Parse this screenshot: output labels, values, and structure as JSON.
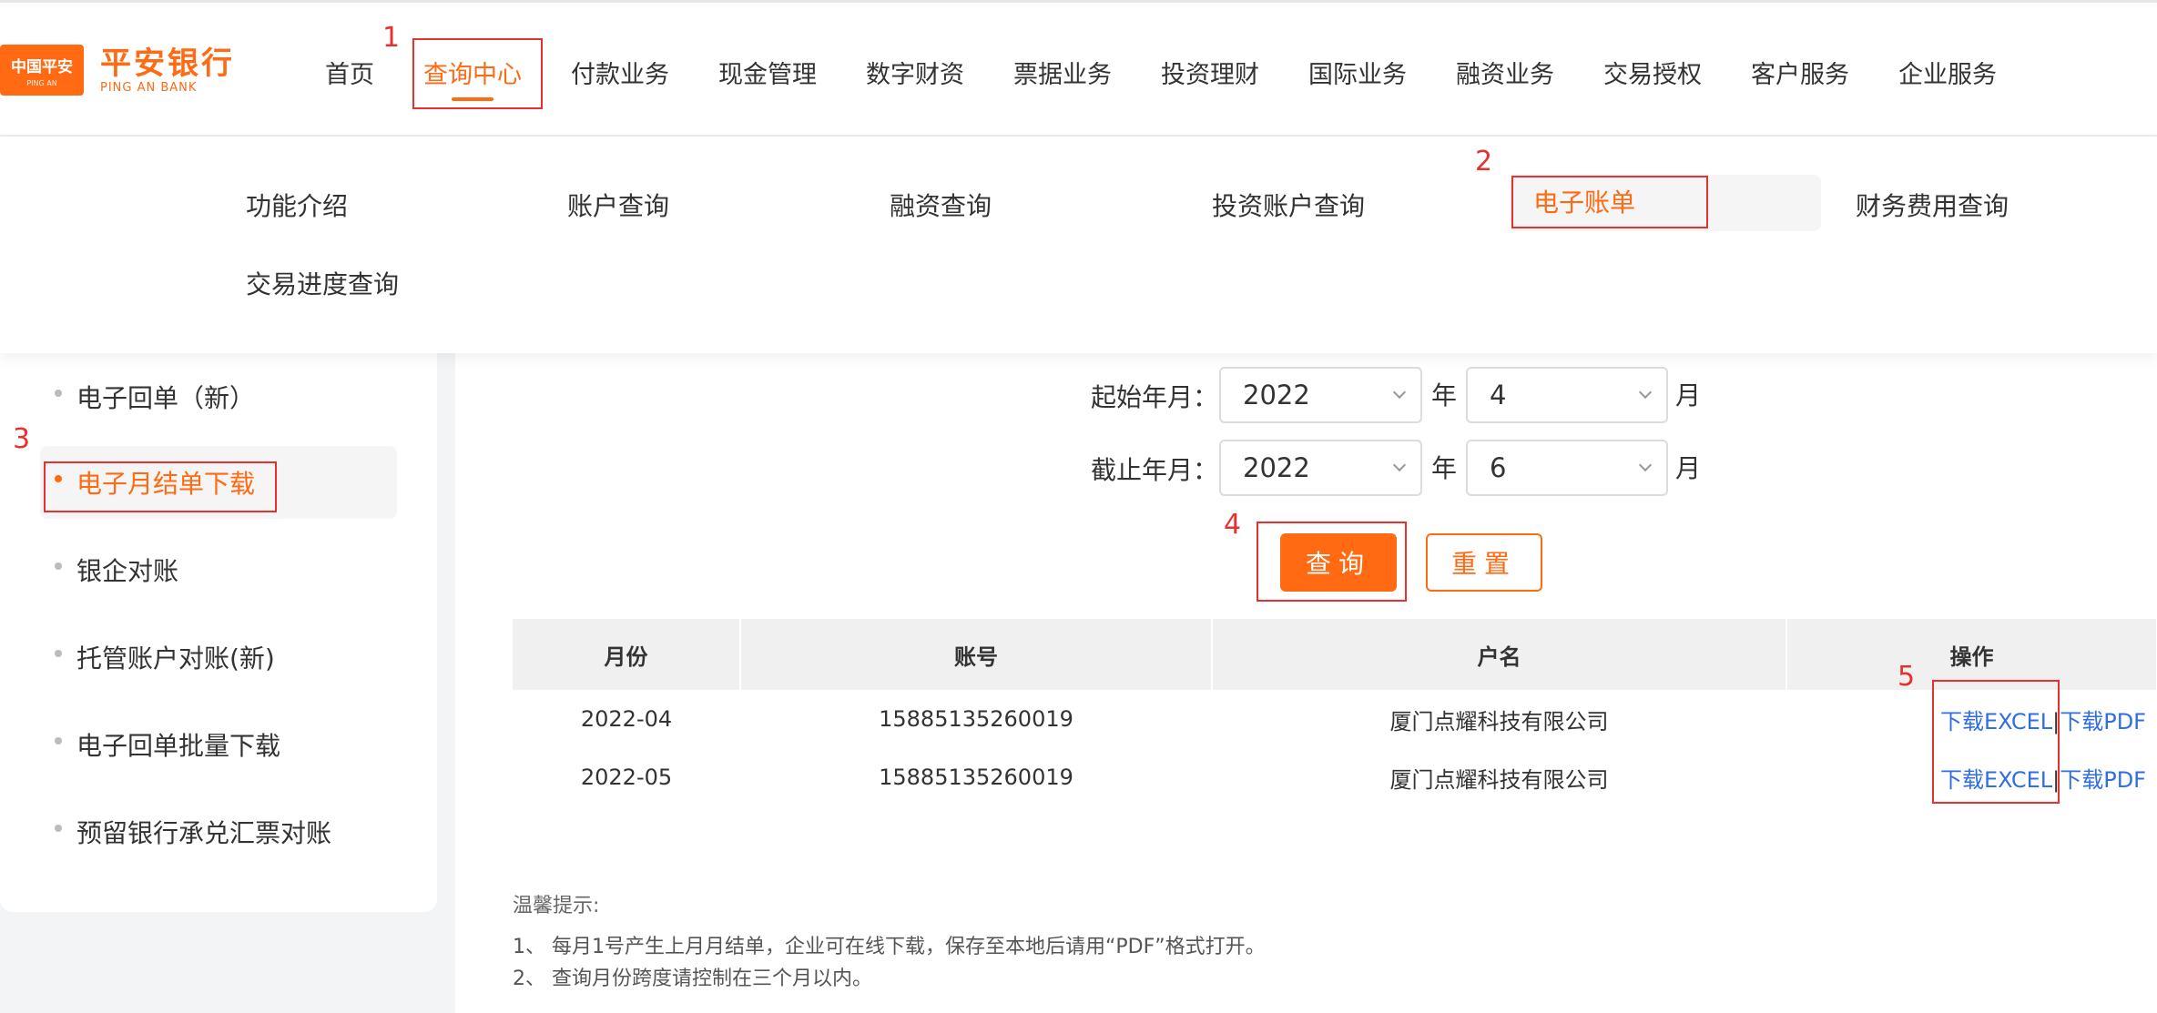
{
  "brand": {
    "badge": "中国平安",
    "badge_sub": "PING AN",
    "name_cn": "平安银行",
    "name_en": "PING AN BANK",
    "color": "#ff6a13"
  },
  "main_nav": [
    "首页",
    "查询中心",
    "付款业务",
    "现金管理",
    "数字财资",
    "票据业务",
    "投资理财",
    "国际业务",
    "融资业务",
    "交易授权",
    "客户服务",
    "企业服务"
  ],
  "sub_menu": [
    "功能介绍",
    "账户查询",
    "融资查询",
    "投资账户查询",
    "电子账单",
    "财务费用查询",
    "交易进度查询"
  ],
  "side_menu": [
    "电子回单（新）",
    "电子月结单下载",
    "银企对账",
    "托管账户对账(新)",
    "电子回单批量下载",
    "预留银行承兑汇票对账"
  ],
  "form": {
    "start_label": "起始年月：",
    "end_label": "截止年月：",
    "start_year": "2022",
    "start_month": "4",
    "end_year": "2022",
    "end_month": "6",
    "year_unit": "年",
    "month_unit": "月",
    "query_button": "查询",
    "reset_button": "重置"
  },
  "table": {
    "headers": [
      "月份",
      "账号",
      "户名",
      "操作"
    ],
    "rows": [
      {
        "month": "2022-04",
        "account": "15885135260019",
        "name": "厦门点耀科技有限公司"
      },
      {
        "month": "2022-05",
        "account": "15885135260019",
        "name": "厦门点耀科技有限公司"
      }
    ],
    "download_excel": "下载EXCEL",
    "download_pdf": "下载PDF",
    "separator": "|"
  },
  "tips": {
    "title": "温馨提示:",
    "line1": "1、  每月1号产生上月月结单，企业可在线下载，保存至本地后请用“PDF”格式打开。",
    "line2": "2、  查询月份跨度请控制在三个月以内。"
  },
  "annotations": [
    "1",
    "2",
    "3",
    "4",
    "5"
  ],
  "colors": {
    "accent": "#ff6a13",
    "link": "#2f6fe3",
    "annotation": "#e8312f"
  }
}
